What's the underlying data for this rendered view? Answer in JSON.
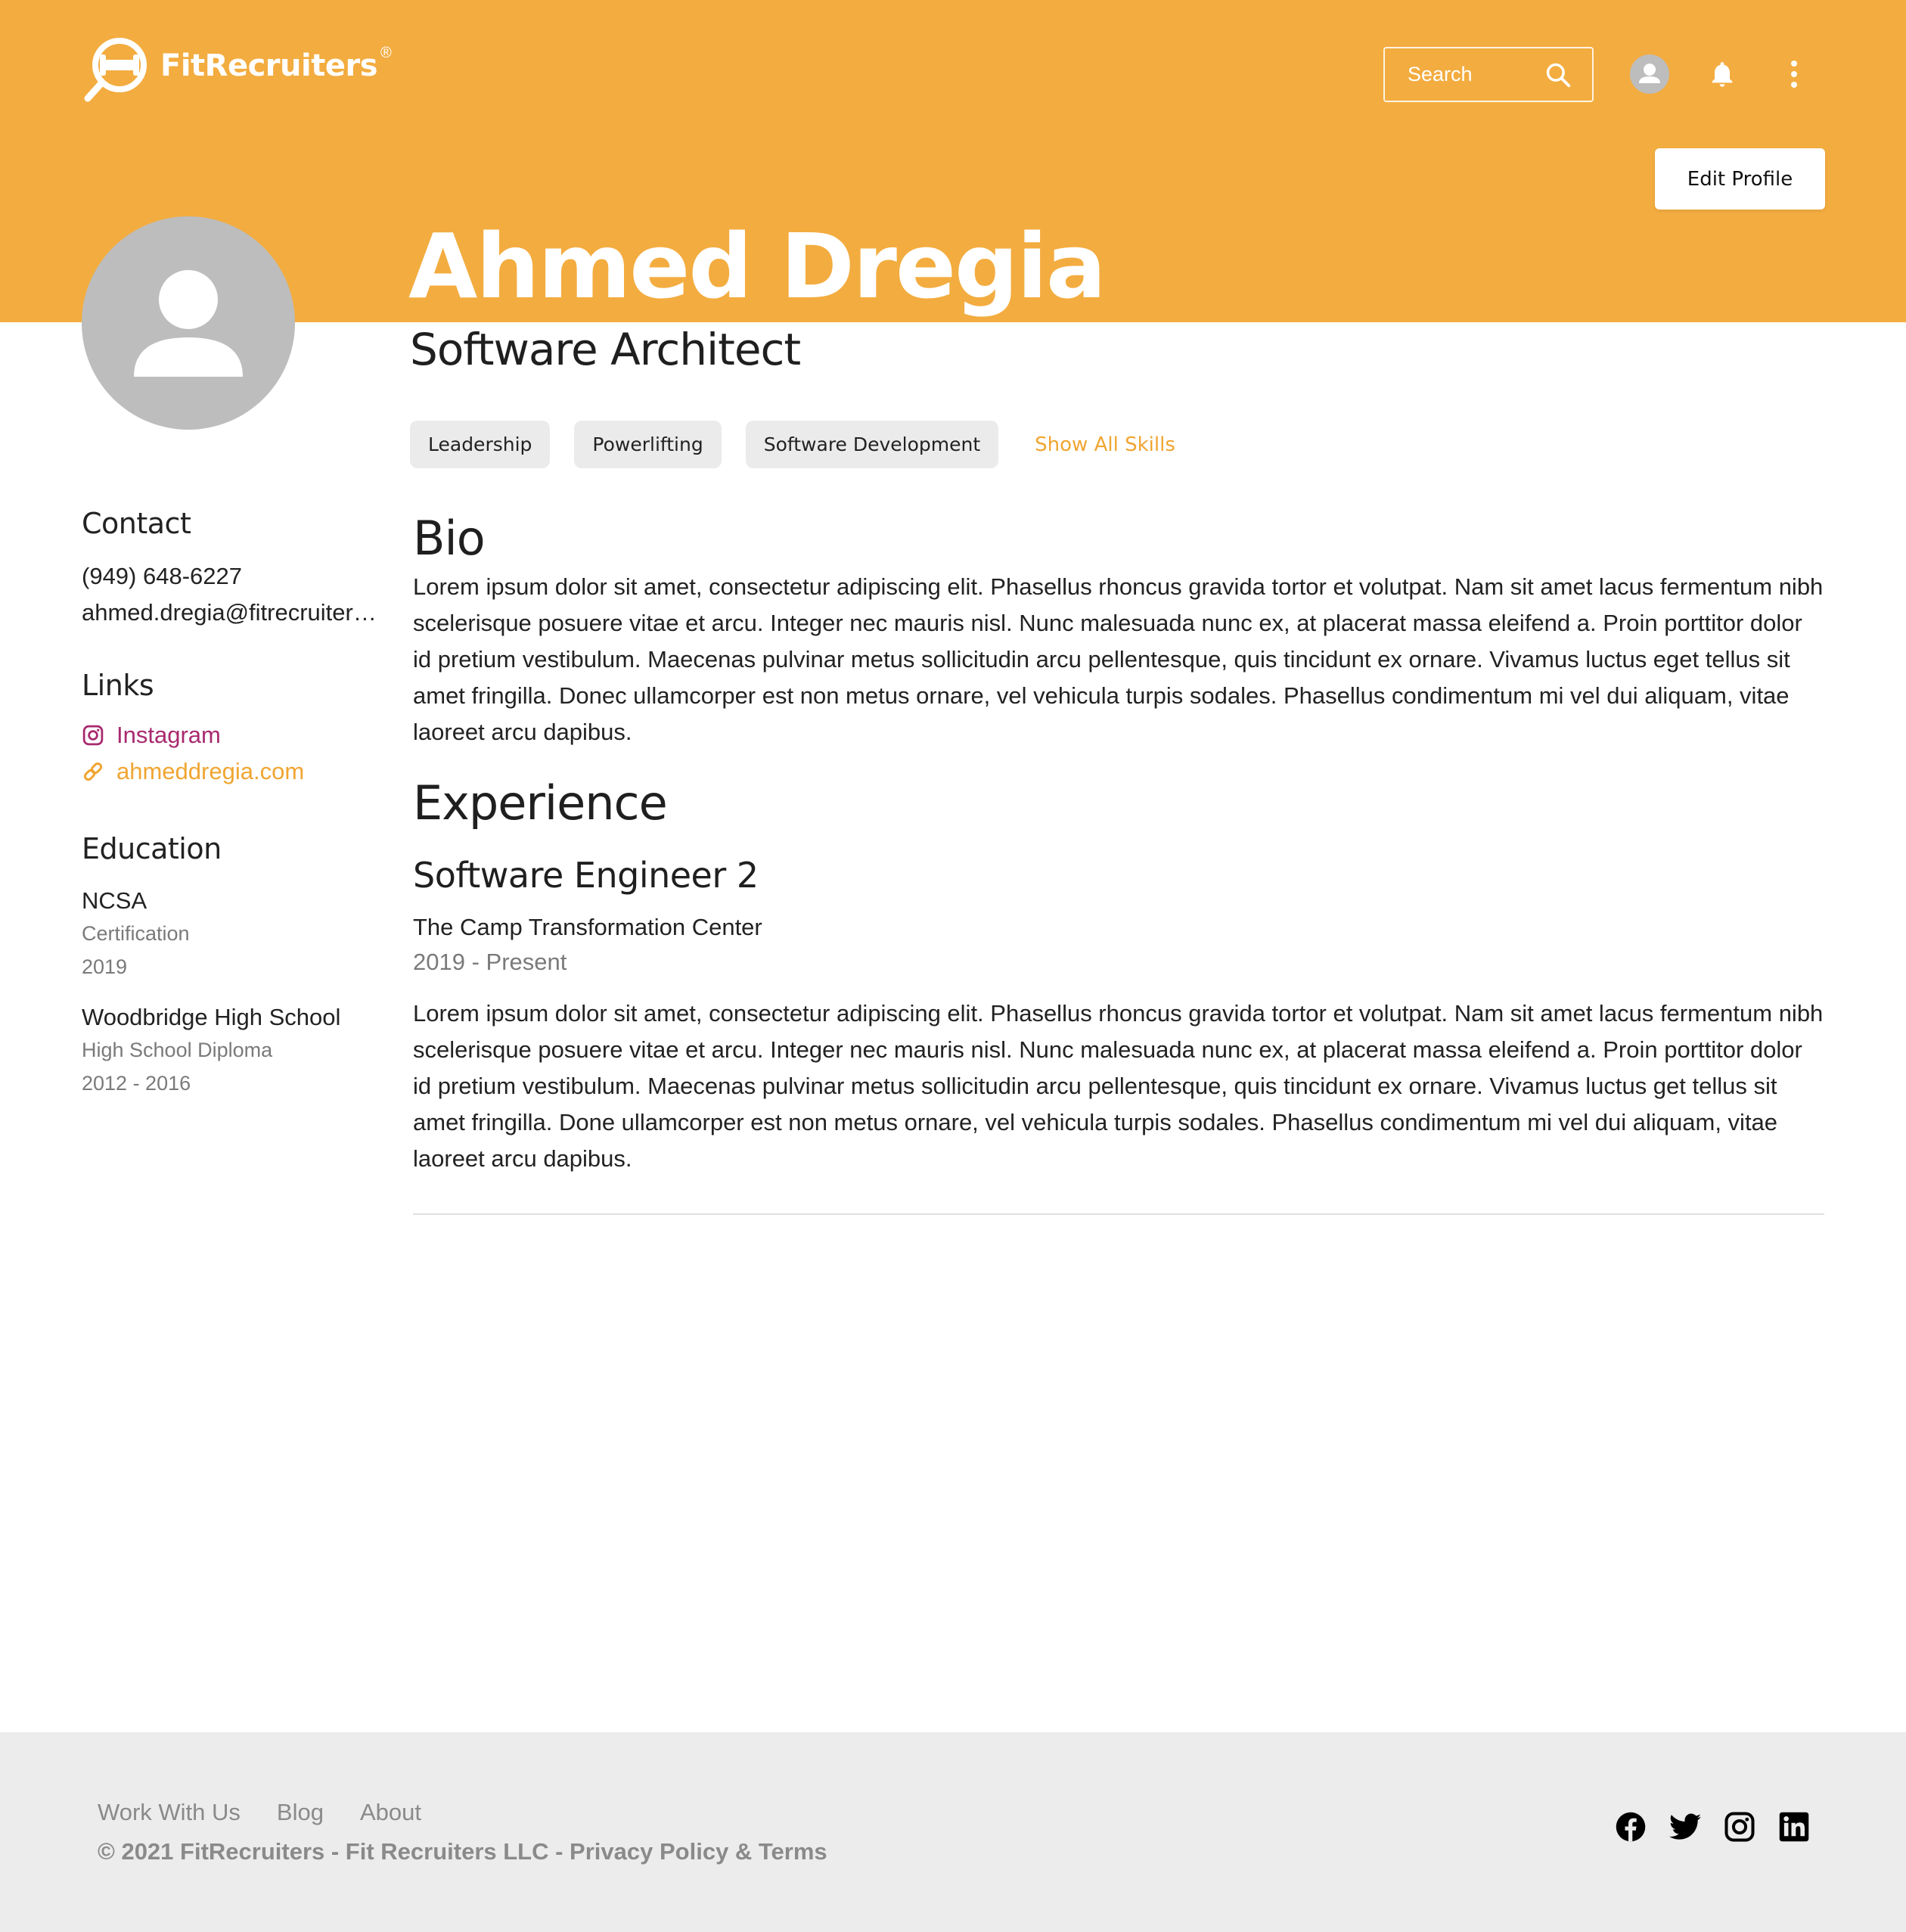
{
  "brand": {
    "name": "FitRecruiters",
    "reg_mark": "®",
    "accent": "#F3AC3F"
  },
  "header": {
    "search_placeholder": "Search",
    "edit_profile_label": "Edit Profile"
  },
  "profile": {
    "name": "Ahmed Dregia",
    "role": "Software Architect",
    "skills": [
      "Leadership",
      "Powerlifting",
      "Software Development"
    ],
    "show_all_skills_label": "Show All Skills"
  },
  "sidebar": {
    "contact": {
      "heading": "Contact",
      "phone": "(949) 648-6227",
      "email": "ahmed.dregia@fitrecruiters.com"
    },
    "links": {
      "heading": "Links",
      "items": [
        {
          "label": "Instagram",
          "icon": "instagram-icon",
          "color": "#A8296E"
        },
        {
          "label": "ahmeddregia.com",
          "icon": "link-icon",
          "color": "#F0A531"
        }
      ]
    },
    "education": {
      "heading": "Education",
      "items": [
        {
          "school": "NCSA",
          "degree": "Certification",
          "years": "2019"
        },
        {
          "school": "Woodbridge High School",
          "degree": "High School Diploma",
          "years": "2012 - 2016"
        }
      ]
    }
  },
  "bio": {
    "heading": "Bio",
    "text": "Lorem ipsum dolor sit amet, consectetur adipiscing elit. Phasellus rhoncus gravida tortor et volutpat. Nam sit amet lacus fermentum nibh scelerisque posuere vitae et arcu. Integer nec mauris nisl. Nunc malesuada nunc ex, at placerat massa eleifend a. Proin porttitor dolor id pretium vestibulum. Maecenas pulvinar metus sollicitudin arcu pellentesque, quis tincidunt ex ornare. Vivamus luctus eget tellus sit amet fringilla. Donec ullamcorper est non metus ornare, vel vehicula turpis sodales. Phasellus condimentum mi vel dui aliquam, vitae laoreet arcu dapibus."
  },
  "experience": {
    "heading": "Experience",
    "items": [
      {
        "title": "Software Engineer 2",
        "company": "The Camp Transformation Center",
        "dates": "2019 - Present",
        "description": "Lorem ipsum dolor sit amet, consectetur adipiscing elit. Phasellus rhoncus gravida tortor et volutpat. Nam sit amet lacus fermentum nibh scelerisque posuere vitae et arcu. Integer nec mauris nisl. Nunc malesuada nunc ex, at placerat massa eleifend a. Proin porttitor dolor id pretium vestibulum. Maecenas pulvinar metus sollicitudin arcu pellentesque, quis tincidunt ex ornare. Vivamus luctus get tellus sit amet fringilla. Done ullamcorper est non metus ornare, vel vehicula turpis sodales. Phasellus condimentum mi vel dui aliquam, vitae laoreet arcu dapibus."
      }
    ]
  },
  "footer": {
    "nav": [
      "Work With Us",
      "Blog",
      "About"
    ],
    "copyright": "© 2021 FitRecruiters - Fit Recruiters LLC - Privacy Policy & Terms",
    "socials": [
      "facebook-icon",
      "twitter-icon",
      "instagram-icon",
      "linkedin-icon"
    ]
  }
}
